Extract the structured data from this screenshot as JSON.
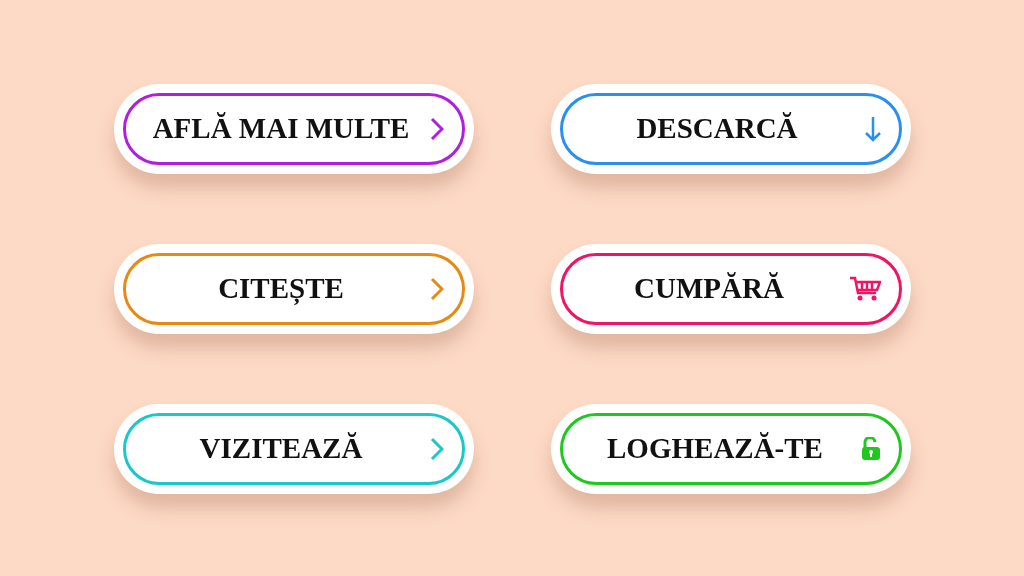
{
  "buttons": [
    {
      "label": "AFLĂ MAI MULTE",
      "kind": "chevron",
      "color": "#b01ee0"
    },
    {
      "label": "DESCARCĂ",
      "kind": "download",
      "color": "#2b8ff0"
    },
    {
      "label": "CITEȘTE",
      "kind": "chevron",
      "color": "#e68a14"
    },
    {
      "label": "CUMPĂRĂ",
      "kind": "cart",
      "color": "#f01464"
    },
    {
      "label": "VIZITEAZĂ",
      "kind": "chevron",
      "color": "#1ac8c8"
    },
    {
      "label": "LOGHEAZĂ-TE",
      "kind": "lock",
      "color": "#1ec81e"
    }
  ]
}
